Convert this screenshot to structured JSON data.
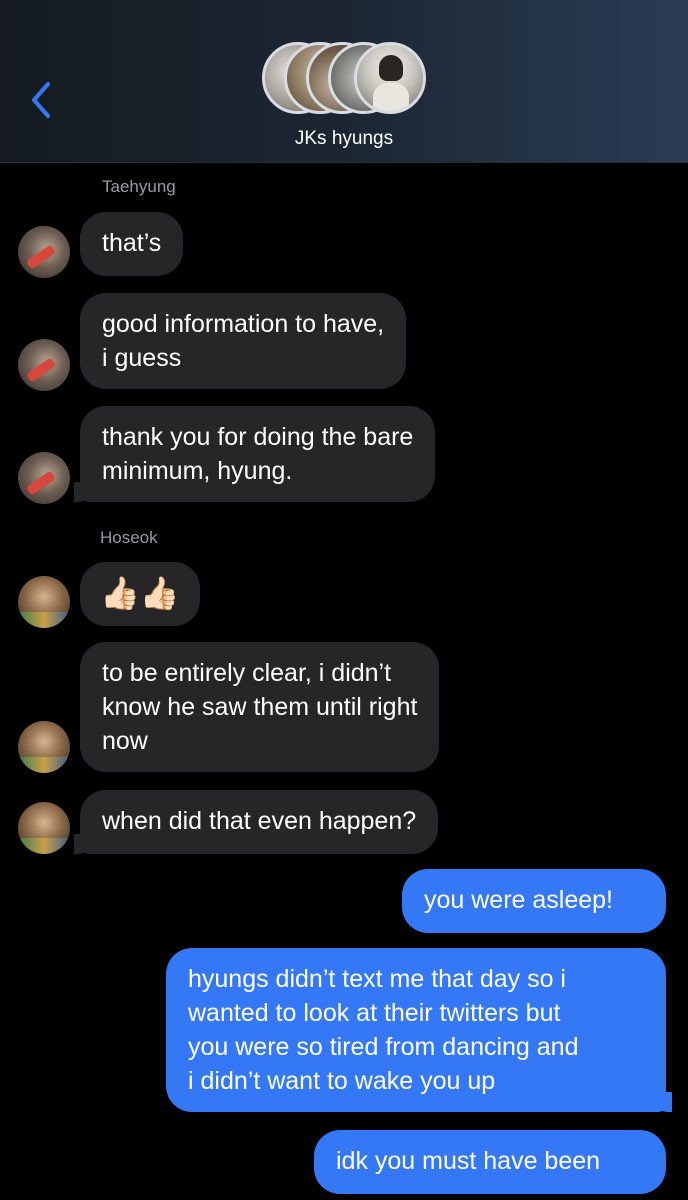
{
  "header": {
    "back_icon": "chevron-left-icon",
    "title": "JKs hyungs",
    "accent": "#3478f6"
  },
  "messages": [
    {
      "sender": "Taehyung",
      "text": "that’s",
      "direction": "incoming"
    },
    {
      "sender": "Taehyung",
      "text": "good information to have,\ni guess",
      "direction": "incoming"
    },
    {
      "sender": "Taehyung",
      "text": "thank you for doing the bare\nminimum, hyung.",
      "direction": "incoming"
    },
    {
      "sender": "Hoseok",
      "text": "👍🏻👍🏻",
      "direction": "incoming"
    },
    {
      "sender": "Hoseok",
      "text": "to be entirely clear, i didn’t\nknow he saw them until right\nnow",
      "direction": "incoming"
    },
    {
      "sender": "Hoseok",
      "text": "when did that even happen?",
      "direction": "incoming"
    },
    {
      "sender": "me",
      "text": "you were asleep!",
      "direction": "outgoing"
    },
    {
      "sender": "me",
      "text": "hyungs didn’t text me that day so i\nwanted to look at their twitters but\nyou were so tired from dancing and\ni didn’t want to wake you up",
      "direction": "outgoing"
    },
    {
      "sender": "me",
      "text": "idk you must have been",
      "direction": "outgoing"
    }
  ],
  "senders": {
    "taehyung": "Taehyung",
    "hoseok": "Hoseok"
  },
  "colors": {
    "incoming_bubble": "#262628",
    "outgoing_bubble": "#3478f6",
    "background": "#000000"
  }
}
